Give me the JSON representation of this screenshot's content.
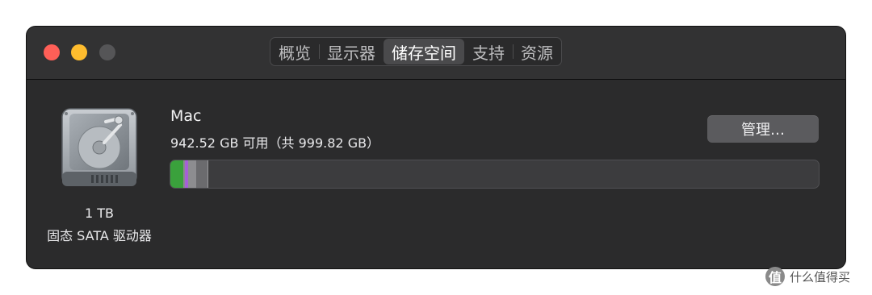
{
  "window": {
    "tabs": [
      {
        "label": "概览",
        "active": false
      },
      {
        "label": "显示器",
        "active": false
      },
      {
        "label": "储存空间",
        "active": true
      },
      {
        "label": "支持",
        "active": false
      },
      {
        "label": "资源",
        "active": false
      }
    ]
  },
  "disk": {
    "capacity_label": "1 TB",
    "type_label": "固态 SATA 驱动器",
    "icon": "hard-drive-icon"
  },
  "volume": {
    "name": "Mac",
    "availability": "942.52 GB 可用（共 999.82 GB）",
    "manage_label": "管理…"
  },
  "usage_bar": {
    "used_fraction": 0.057,
    "colors": [
      "#3aa13c",
      "#a561d6",
      "#8d8d90",
      "#6b6b6e"
    ]
  },
  "watermark": {
    "text": "什么值得买",
    "icon_glyph": "值"
  }
}
